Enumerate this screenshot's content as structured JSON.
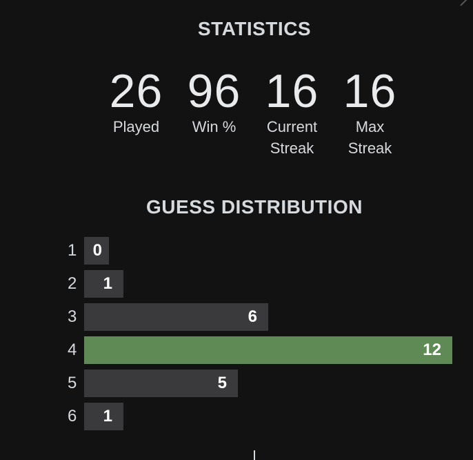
{
  "statistics": {
    "title": "STATISTICS",
    "items": [
      {
        "value": "26",
        "label": "Played"
      },
      {
        "value": "96",
        "label": "Win %"
      },
      {
        "value": "16",
        "label": "Current\nStreak"
      },
      {
        "value": "16",
        "label": "Max\nStreak"
      }
    ]
  },
  "guess_distribution": {
    "title": "GUESS DISTRIBUTION",
    "highlight_color": "#5f8a55",
    "bar_color": "#3a3a3c",
    "rows": [
      {
        "guess": "1",
        "count": 0,
        "highlight": false
      },
      {
        "guess": "2",
        "count": 1,
        "highlight": false
      },
      {
        "guess": "3",
        "count": 6,
        "highlight": false
      },
      {
        "guess": "4",
        "count": 12,
        "highlight": true
      },
      {
        "guess": "5",
        "count": 5,
        "highlight": false
      },
      {
        "guess": "6",
        "count": 1,
        "highlight": false
      }
    ]
  },
  "chart_data": {
    "type": "bar",
    "categories": [
      "1",
      "2",
      "3",
      "4",
      "5",
      "6"
    ],
    "values": [
      0,
      1,
      6,
      12,
      5,
      1
    ],
    "title": "GUESS DISTRIBUTION",
    "xlabel": "",
    "ylabel": ""
  },
  "icons": {
    "close": "close-icon"
  }
}
